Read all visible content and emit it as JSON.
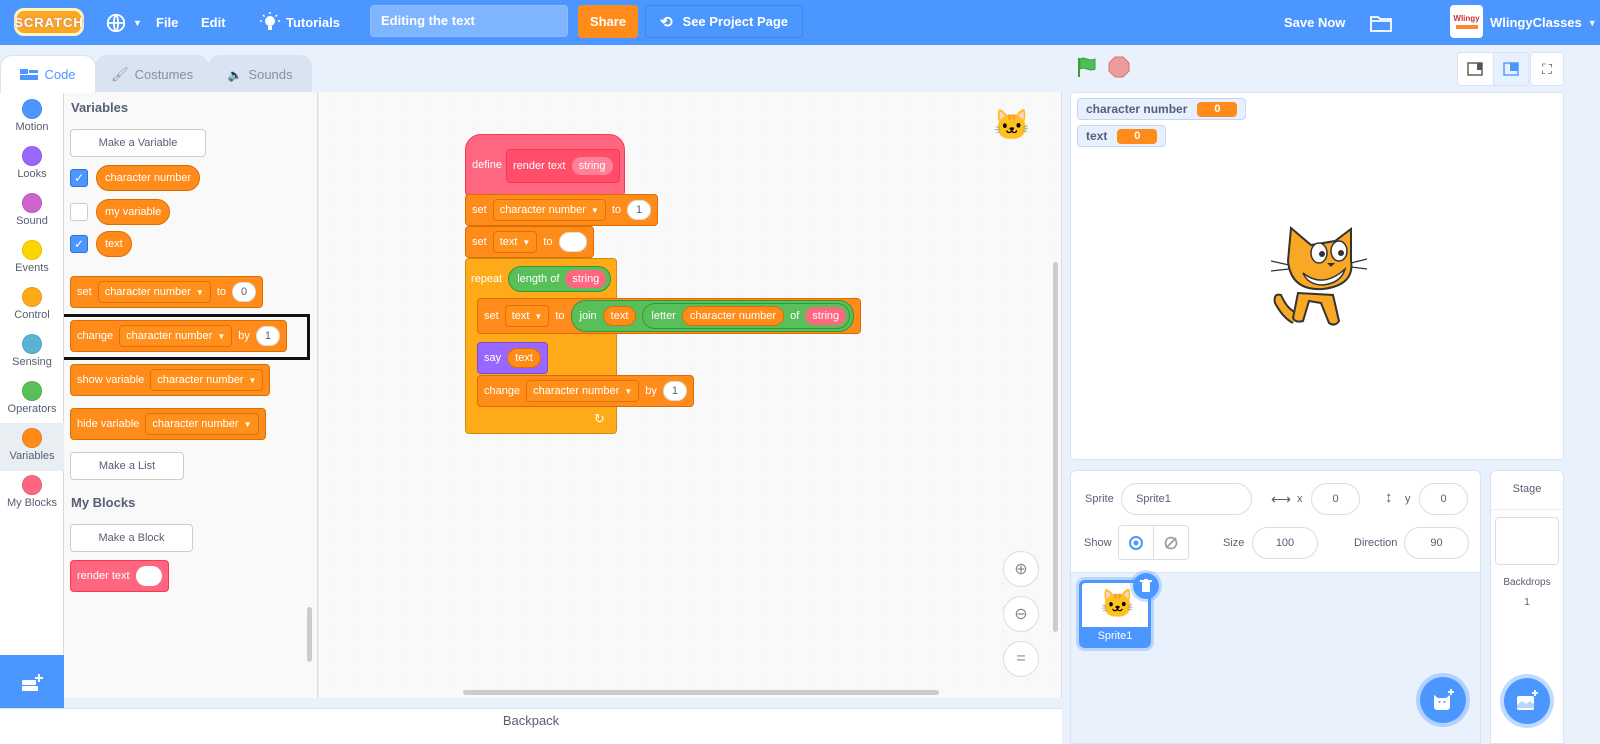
{
  "menubar": {
    "logo": "SCRATCH",
    "file": "File",
    "edit": "Edit",
    "tutorials": "Tutorials",
    "project_title": "Editing the text",
    "share": "Share",
    "see_project_page": "See Project Page",
    "save_now": "Save Now",
    "username": "WlingyClasses",
    "avatar_text": "Wlingy"
  },
  "tabs": [
    {
      "label": "Code",
      "active": true
    },
    {
      "label": "Costumes",
      "active": false
    },
    {
      "label": "Sounds",
      "active": false
    }
  ],
  "categories": [
    {
      "label": "Motion",
      "color": "#4c97ff"
    },
    {
      "label": "Looks",
      "color": "#9966ff"
    },
    {
      "label": "Sound",
      "color": "#cf63cf"
    },
    {
      "label": "Events",
      "color": "#ffd500"
    },
    {
      "label": "Control",
      "color": "#ffab19"
    },
    {
      "label": "Sensing",
      "color": "#5cb1d6"
    },
    {
      "label": "Operators",
      "color": "#59c059"
    },
    {
      "label": "Variables",
      "color": "#ff8c1a"
    },
    {
      "label": "My Blocks",
      "color": "#ff6680"
    }
  ],
  "palette": {
    "variables_heading": "Variables",
    "make_variable": "Make a Variable",
    "variables": [
      {
        "name": "character number",
        "checked": true
      },
      {
        "name": "my variable",
        "checked": false
      },
      {
        "name": "text",
        "checked": true
      }
    ],
    "set_block": {
      "verb": "set",
      "var": "character number",
      "to": "to",
      "value": "0"
    },
    "change_block": {
      "verb": "change",
      "var": "character number",
      "by": "by",
      "value": "1"
    },
    "show_block": {
      "verb": "show variable",
      "var": "character number"
    },
    "hide_block": {
      "verb": "hide variable",
      "var": "character number"
    },
    "make_list": "Make a List",
    "myblocks_heading": "My Blocks",
    "make_block": "Make a Block",
    "render_text_block": "render text"
  },
  "script": {
    "define": "define",
    "proc_name": "render text",
    "param": "string",
    "set1": {
      "verb": "set",
      "var": "character number",
      "to": "to",
      "value": "1"
    },
    "set2": {
      "verb": "set",
      "var": "text",
      "to": "to",
      "value": ""
    },
    "repeat": {
      "verb": "repeat",
      "op": "length of",
      "arg": "string"
    },
    "set3": {
      "verb": "set",
      "var": "text",
      "to": "to",
      "join": "join",
      "join_arg": "text",
      "letter": "letter",
      "letter_arg": "character number",
      "of": "of",
      "of_arg": "string"
    },
    "say": {
      "verb": "say",
      "arg": "text"
    },
    "change": {
      "verb": "change",
      "var": "character number",
      "by": "by",
      "value": "1"
    }
  },
  "backpack": "Backpack",
  "stage_monitors": [
    {
      "label": "character number",
      "value": "0"
    },
    {
      "label": "text",
      "value": "0"
    }
  ],
  "sprite_info": {
    "sprite_label": "Sprite",
    "sprite_name": "Sprite1",
    "x_label": "x",
    "x": "0",
    "y_label": "y",
    "y": "0",
    "show_label": "Show",
    "size_label": "Size",
    "size": "100",
    "direction_label": "Direction",
    "direction": "90"
  },
  "sprites": [
    {
      "name": "Sprite1",
      "selected": true
    }
  ],
  "stage_panel": {
    "label": "Stage",
    "backdrops_label": "Backdrops",
    "backdrops_count": "1"
  },
  "colors": {
    "accent": "#4c97ff",
    "variables": "#ff8c1a",
    "myblocks": "#ff6680",
    "operators": "#59c059",
    "looks": "#9966ff",
    "control": "#ffab19"
  }
}
